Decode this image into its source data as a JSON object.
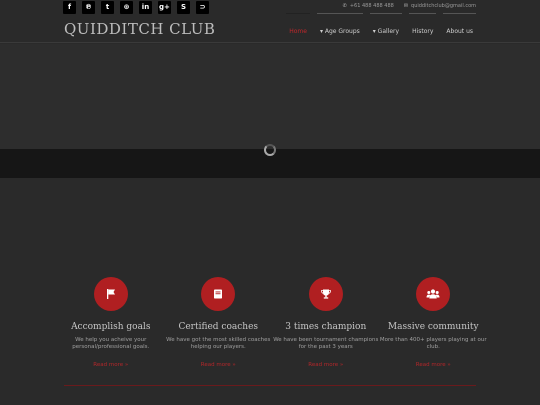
{
  "social": [
    {
      "name": "facebook-icon",
      "glyph": "f"
    },
    {
      "name": "pinterest-icon",
      "glyph": "℗"
    },
    {
      "name": "twitter-icon",
      "glyph": "t"
    },
    {
      "name": "dribbble-icon",
      "glyph": "⊛"
    },
    {
      "name": "linkedin-icon",
      "glyph": "in"
    },
    {
      "name": "google-plus-icon",
      "glyph": "g+"
    },
    {
      "name": "skype-icon",
      "glyph": "S"
    },
    {
      "name": "rss-icon",
      "glyph": "⊃"
    }
  ],
  "contact": {
    "phone": "+61 488 488 488",
    "email": "quidditchclub@gmail.com"
  },
  "logo": "QUIDDITCH CLUB",
  "nav": [
    {
      "label": "Home",
      "active": true
    },
    {
      "label": "▾ Age Groups",
      "active": false
    },
    {
      "label": "▾ Gallery",
      "active": false
    },
    {
      "label": "History",
      "active": false
    },
    {
      "label": "About us",
      "active": false
    }
  ],
  "features": [
    {
      "icon": "flag-icon",
      "title": "Accomplish goals",
      "desc": "We help you acheive your personal/professional goals.",
      "link": "Read more »"
    },
    {
      "icon": "book-icon",
      "title": "Certified coaches",
      "desc": "We have got the most skilled coaches helping our players.",
      "link": "Read more »"
    },
    {
      "icon": "trophy-icon",
      "title": "3 times champion",
      "desc": "We have been tournament champions for the past 3 years",
      "link": "Read more »"
    },
    {
      "icon": "users-icon",
      "title": "Massive community",
      "desc": "More than 400+ players playing at our club.",
      "link": "Read more »"
    }
  ],
  "colors": {
    "accent": "#b01f21",
    "background": "#2a2a2a"
  }
}
